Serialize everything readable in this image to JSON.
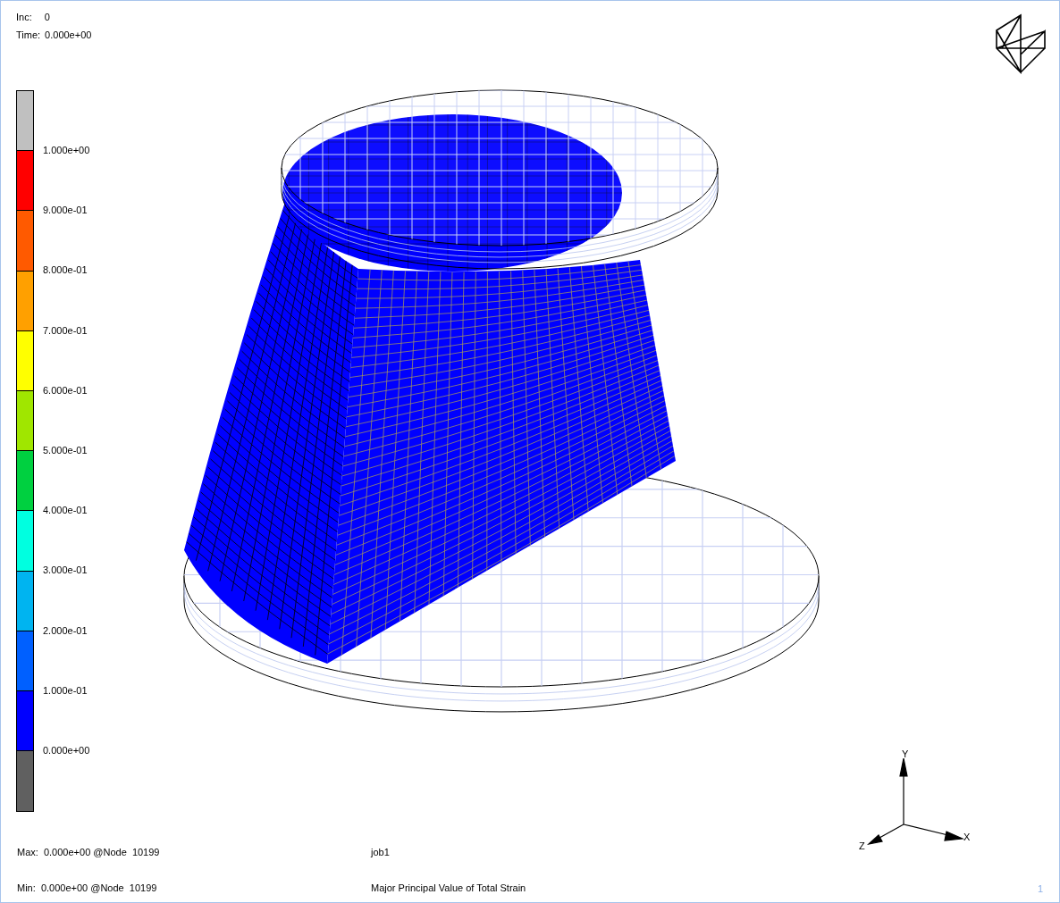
{
  "header": {
    "inc_label": "Inc:",
    "inc": "0",
    "time_label": "Time:",
    "time": "0.000e+00"
  },
  "legend": {
    "bands": [
      {
        "color": "#c0c0c0"
      },
      {
        "color": "#ff0000"
      },
      {
        "color": "#ff5a00"
      },
      {
        "color": "#ffa000"
      },
      {
        "color": "#ffff00"
      },
      {
        "color": "#a0e600"
      },
      {
        "color": "#00d040"
      },
      {
        "color": "#00ffe0"
      },
      {
        "color": "#00b4f0"
      },
      {
        "color": "#0060ff"
      },
      {
        "color": "#0000ff"
      },
      {
        "color": "#606060"
      }
    ],
    "labels": [
      "1.000e+00",
      "9.000e-01",
      "8.000e-01",
      "7.000e-01",
      "6.000e-01",
      "5.000e-01",
      "4.000e-01",
      "3.000e-01",
      "2.000e-01",
      "1.000e-01",
      "0.000e+00"
    ]
  },
  "axes": {
    "y": "Y",
    "x": "X",
    "z": "Z"
  },
  "footer": {
    "max": "Max:  0.000e+00 @Node  10199",
    "min": "Min:  0.000e+00 @Node  10199",
    "job": "job1",
    "quantity": "Major Principal Value of Total Strain",
    "page": "1"
  }
}
